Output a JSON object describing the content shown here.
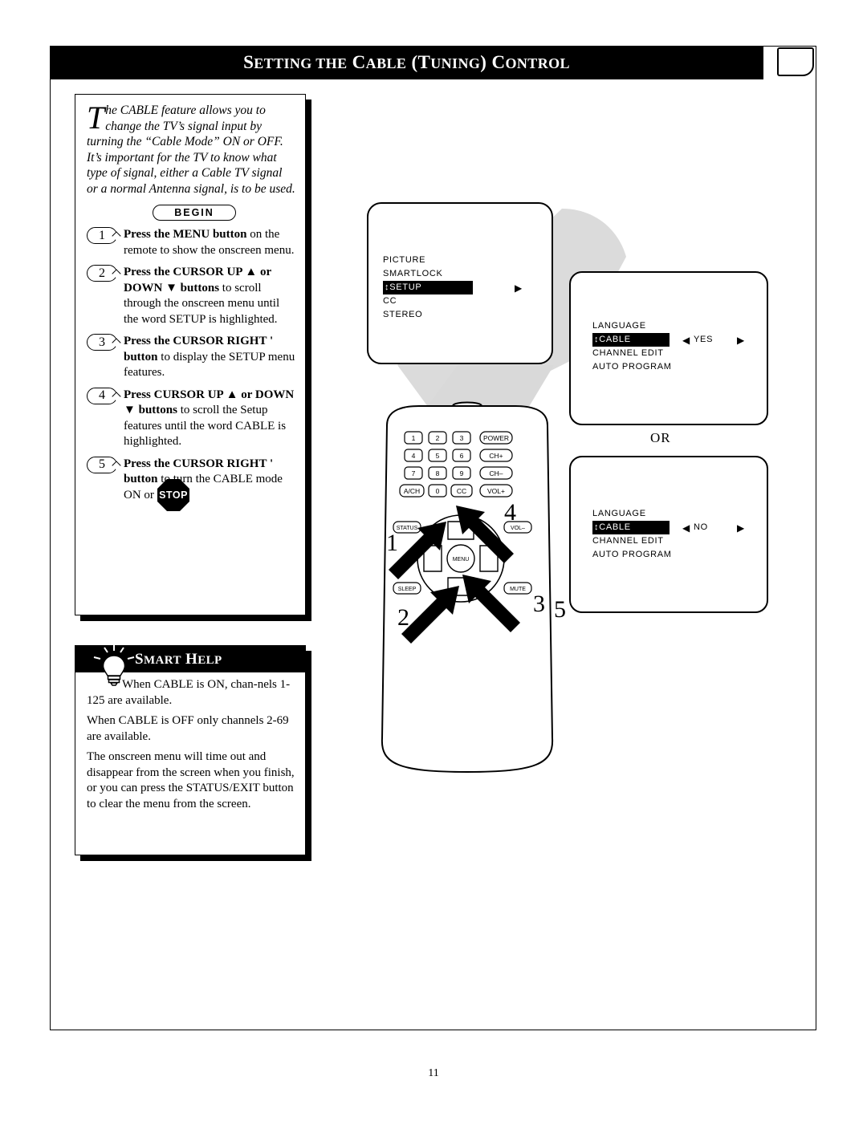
{
  "page": {
    "title_main": "SETTING THE CABLE (TUNING) CONTROL",
    "number": "11"
  },
  "intro": {
    "dropcap": "T",
    "text": "he CABLE feature allows you to change the TV’s signal input by turning the “Cable Mode” ON or OFF. It’s important for the TV to know what type of signal, either a Cable TV signal or a normal Antenna signal, is to be used."
  },
  "begin_label": "BEGIN",
  "stop_label": "STOP",
  "steps": [
    {
      "num": "1",
      "bold": "Press the MENU button",
      "rest": " on the remote to show the onscreen menu."
    },
    {
      "num": "2",
      "bold": "Press the CURSOR UP ▲ or DOWN ▼ buttons",
      "rest": " to scroll through the onscreen menu until the word SETUP is highlighted."
    },
    {
      "num": "3",
      "bold": "Press the CURSOR RIGHT ' button",
      "rest": " to display the SETUP menu features."
    },
    {
      "num": "4",
      "bold": "Press CURSOR UP ▲ or DOWN ▼ buttons",
      "rest": " to scroll the Setup features until the word CABLE is highlighted."
    },
    {
      "num": "5",
      "bold": "Press the CURSOR RIGHT ' button",
      "rest": " to turn the CABLE mode ON or OFF."
    }
  ],
  "smart_help": {
    "heading": "SMART HELP",
    "paragraphs": [
      "When CABLE is ON, chan-nels 1-125 are available.",
      "When CABLE is OFF only channels 2-69 are available.",
      "The onscreen menu will time out and disappear from the screen when you finish, or you can press the STATUS/EXIT button to clear the menu from the screen."
    ]
  },
  "osd": {
    "menu1": {
      "items": [
        "PICTURE",
        "SMARTLOCK",
        "SETUP",
        "CC",
        "STEREO"
      ],
      "highlighted": "SETUP",
      "arrow": "▶"
    },
    "menu2": {
      "items": [
        "LANGUAGE",
        "CABLE",
        "CHANNEL EDIT",
        "AUTO PROGRAM"
      ],
      "highlighted": "CABLE",
      "value": "YES",
      "left_arrow": "◀",
      "right_arrow": "▶"
    },
    "menu3": {
      "items": [
        "LANGUAGE",
        "CABLE",
        "CHANNEL EDIT",
        "AUTO PROGRAM"
      ],
      "highlighted": "CABLE",
      "value": "NO",
      "left_arrow": "◀",
      "right_arrow": "▶"
    },
    "or_label": "OR"
  },
  "remote": {
    "keys": [
      [
        "1",
        "2",
        "3",
        "POWER"
      ],
      [
        "4",
        "5",
        "6",
        "CH+"
      ],
      [
        "7",
        "8",
        "9",
        "CH–"
      ],
      [
        "A/CH",
        "0",
        "CC",
        "VOL+"
      ]
    ],
    "left_side": [
      "STATUS",
      "SLEEP"
    ],
    "right_side": [
      "VOL–",
      "MUTE"
    ],
    "center": "MENU"
  },
  "callouts": [
    "1",
    "2",
    "3",
    "4",
    "5"
  ]
}
